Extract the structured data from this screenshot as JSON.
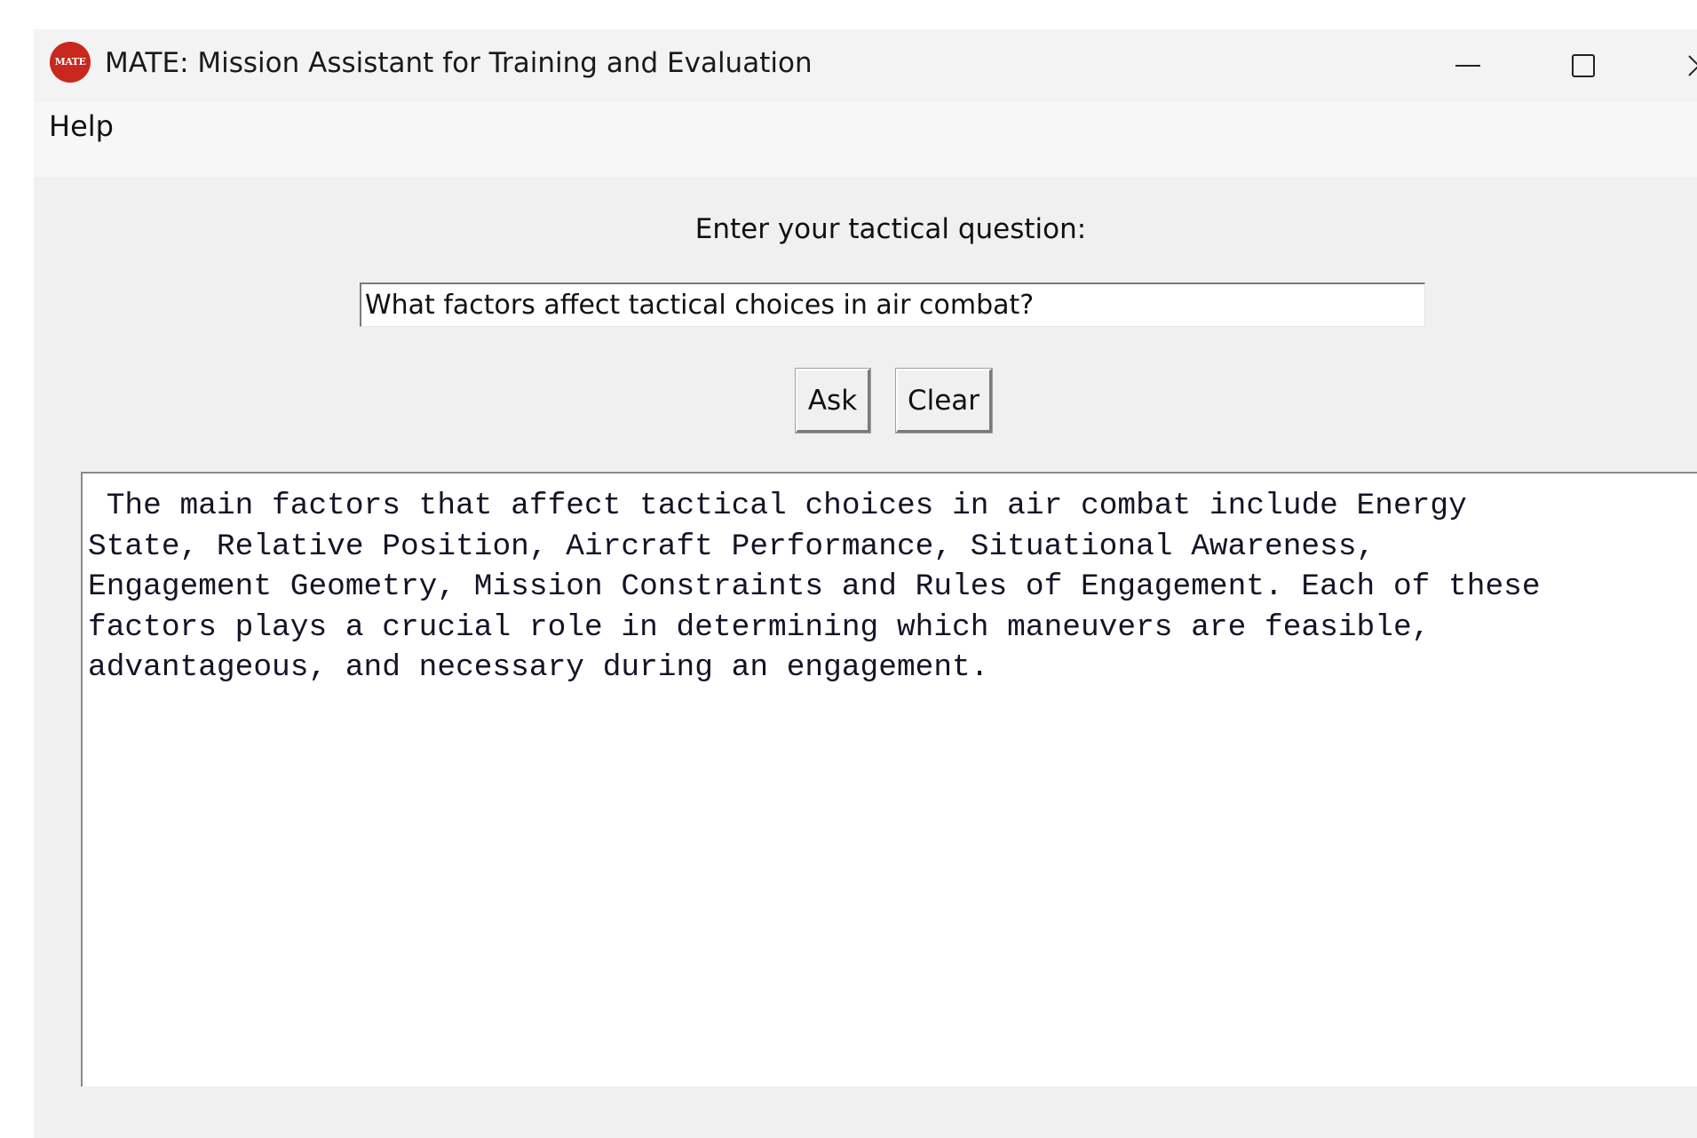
{
  "window": {
    "title": "MATE: Mission Assistant for Training and Evaluation",
    "logo_text": "MATE",
    "logo_color": "#c8281e",
    "controls": [
      "minimize-icon",
      "maximize-icon",
      "close-icon"
    ]
  },
  "menubar": {
    "help_label": "Help"
  },
  "main": {
    "prompt_label": "Enter your tactical question:",
    "question_value": "What factors affect tactical choices in air combat?",
    "ask_label": "Ask",
    "clear_label": "Clear",
    "response_text": " The main factors that affect tactical choices in air combat include Energy\nState, Relative Position, Aircraft Performance, Situational Awareness,\nEngagement Geometry, Mission Constraints and Rules of Engagement. Each of these\nfactors plays a crucial role in determining which maneuvers are feasible,\nadvantageous, and necessary during an engagement."
  }
}
